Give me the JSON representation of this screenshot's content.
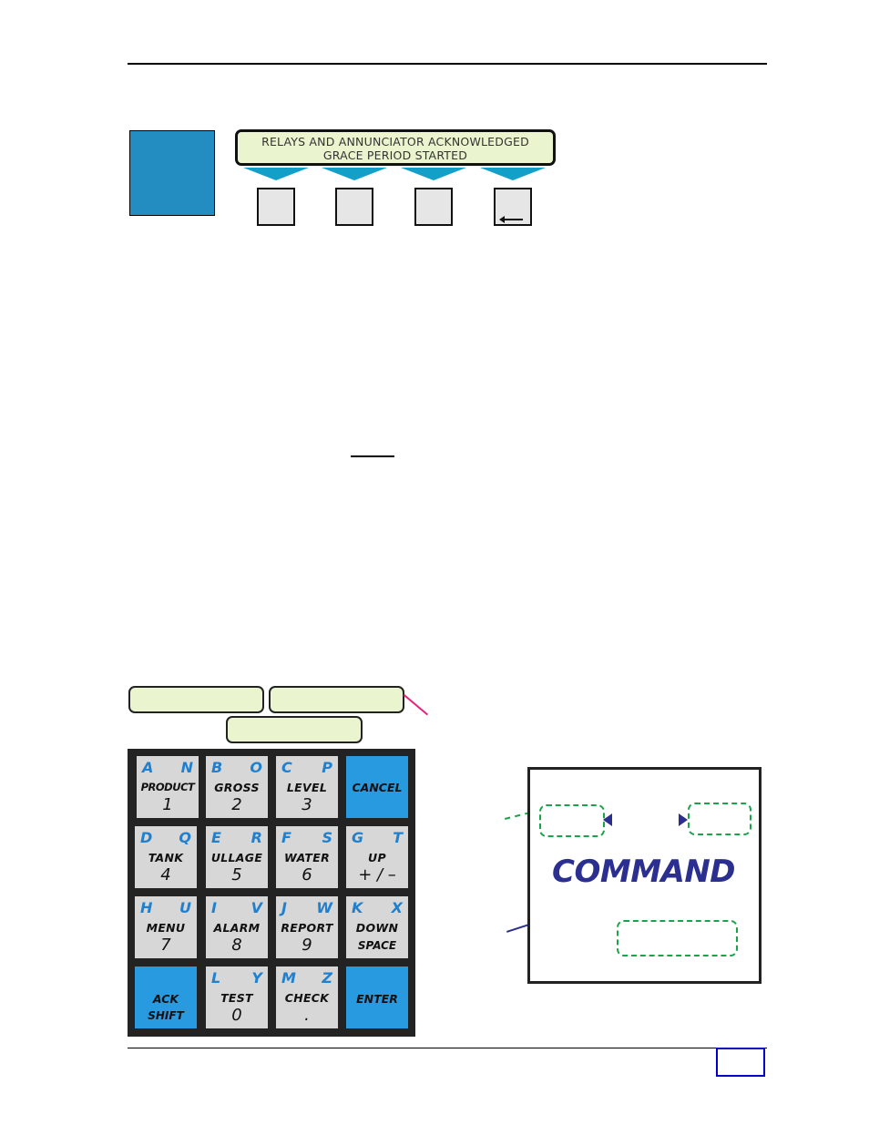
{
  "page": {
    "page_number_box": ""
  },
  "display_panel": {
    "lcd_line1": "RELAYS AND ANNUNCIATOR ACKNOWLEDGED",
    "lcd_line2": "GRACE PERIOD STARTED",
    "softkeys": [
      {
        "label": "",
        "icon": "blank"
      },
      {
        "label": "",
        "icon": "blank"
      },
      {
        "label": "",
        "icon": "blank"
      },
      {
        "label": "",
        "icon": "back-arrow-icon"
      }
    ]
  },
  "callout_boxes": [
    "",
    "",
    ""
  ],
  "keypad": {
    "accent_color": "#289ae0",
    "keys": [
      {
        "letters": [
          "A",
          "N"
        ],
        "function": "PRODUCT",
        "number": "1",
        "type": "gray"
      },
      {
        "letters": [
          "B",
          "O"
        ],
        "function": "GROSS",
        "number": "2",
        "type": "gray"
      },
      {
        "letters": [
          "C",
          "P"
        ],
        "function": "LEVEL",
        "number": "3",
        "type": "gray"
      },
      {
        "letters": [
          "",
          ""
        ],
        "function": "CANCEL",
        "number": "",
        "type": "blue"
      },
      {
        "letters": [
          "D",
          "Q"
        ],
        "function": "TANK",
        "number": "4",
        "type": "gray"
      },
      {
        "letters": [
          "E",
          "R"
        ],
        "function": "ULLAGE",
        "number": "5",
        "type": "gray"
      },
      {
        "letters": [
          "F",
          "S"
        ],
        "function": "WATER",
        "number": "6",
        "type": "gray"
      },
      {
        "letters": [
          "G",
          "T"
        ],
        "function": "UP",
        "number": "+ / –",
        "type": "gray"
      },
      {
        "letters": [
          "H",
          "U"
        ],
        "function": "MENU",
        "number": "7",
        "type": "gray"
      },
      {
        "letters": [
          "I",
          "V"
        ],
        "function": "ALARM",
        "number": "8",
        "type": "gray"
      },
      {
        "letters": [
          "J",
          "W"
        ],
        "function": "REPORT",
        "number": "9",
        "type": "gray"
      },
      {
        "letters": [
          "K",
          "X"
        ],
        "function": "DOWN",
        "sub": "SPACE",
        "type": "gray"
      },
      {
        "letters": [
          "",
          ""
        ],
        "function": "ACK",
        "sub": "SHIFT",
        "type": "blue"
      },
      {
        "letters": [
          "L",
          "Y"
        ],
        "function": "TEST",
        "number": "0",
        "type": "gray"
      },
      {
        "letters": [
          "M",
          "Z"
        ],
        "function": "CHECK",
        "number": ".",
        "type": "gray"
      },
      {
        "letters": [
          "",
          ""
        ],
        "function": "ENTER",
        "number": "",
        "type": "blue"
      }
    ]
  },
  "command_screen": {
    "title": "COMMAND",
    "title_color": "#2b2f8f",
    "dashed_color": "#1aa34a"
  }
}
